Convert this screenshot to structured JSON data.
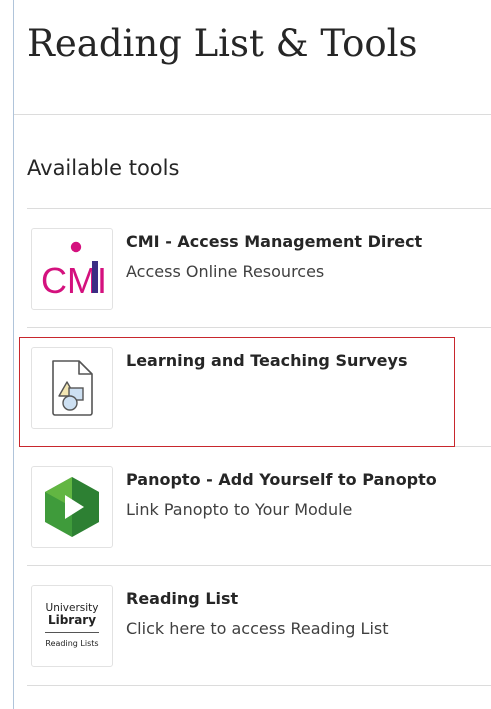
{
  "page": {
    "title": "Reading List & Tools"
  },
  "section": {
    "heading": "Available tools"
  },
  "tools": [
    {
      "name": "CMI - Access Management Direct",
      "description": "Access Online Resources",
      "icon": "cmi-logo-icon",
      "logo_text": "CMI"
    },
    {
      "name": "Learning and Teaching Surveys",
      "description": "",
      "icon": "document-shapes-icon",
      "highlighted": true
    },
    {
      "name": "Panopto - Add Yourself to Panopto",
      "description": "Link Panopto to Your Module",
      "icon": "panopto-logo-icon"
    },
    {
      "name": "Reading List",
      "description": "Click here to access Reading List",
      "icon": "university-library-logo-icon",
      "logo_lines": [
        "University",
        "Library",
        "Reading Lists"
      ]
    }
  ],
  "colors": {
    "cmi_magenta": "#d4117e",
    "cmi_purple": "#3b2d83",
    "panopto_green": "#3f9b3b",
    "panopto_dark_green": "#1f6a2d",
    "highlight_red": "#c8272d",
    "divider": "#dcdcdc",
    "panel_border": "#b0c4da"
  }
}
